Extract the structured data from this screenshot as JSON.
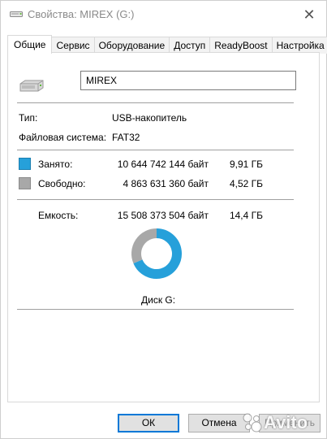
{
  "window": {
    "title": "Свойства: MIREX (G:)",
    "close_glyph": "✕"
  },
  "tabs": [
    {
      "label": "Общие",
      "active": true
    },
    {
      "label": "Сервис",
      "active": false
    },
    {
      "label": "Оборудование",
      "active": false
    },
    {
      "label": "Доступ",
      "active": false
    },
    {
      "label": "ReadyBoost",
      "active": false
    },
    {
      "label": "Настройка",
      "active": false
    }
  ],
  "drive": {
    "icon": "usb-drive-icon",
    "name_value": "MIREX"
  },
  "info": {
    "type_label": "Тип:",
    "type_value": "USB-накопитель",
    "fs_label": "Файловая система:",
    "fs_value": "FAT32"
  },
  "usage": {
    "used_label": "Занято:",
    "used_bytes": "10 644 742 144 байт",
    "used_human": "9,91 ГБ",
    "free_label": "Свободно:",
    "free_bytes": "4 863 631 360 байт",
    "free_human": "4,52 ГБ",
    "capacity_label": "Емкость:",
    "capacity_bytes": "15 508 373 504 байт",
    "capacity_human": "14,4 ГБ",
    "used_fraction": 0.6864,
    "used_color": "#26a0da",
    "free_color": "#a8a8a8"
  },
  "disk_label": "Диск G:",
  "buttons": {
    "ok": "ОК",
    "cancel": "Отмена",
    "apply": "Применить"
  },
  "watermark": {
    "text": "Avito"
  }
}
